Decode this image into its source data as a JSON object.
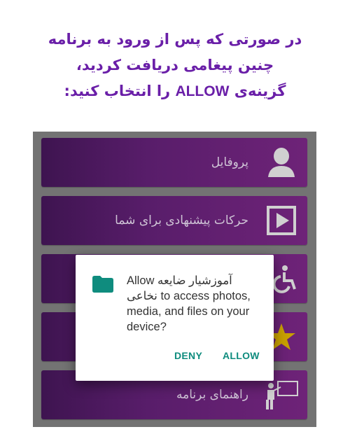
{
  "instruction": {
    "line1": "در صورتی که پس از ورود به برنامه",
    "line2": "چنین پیغامی دریافت کردید،",
    "line3_before": "گزینه‌ی",
    "line3_keyword": "ALLOW",
    "line3_after": "را انتخاب کنید:"
  },
  "menu": {
    "items": [
      {
        "label": "پروفایل",
        "icon": "user-icon"
      },
      {
        "label": "حرکات پیشنهادی برای شما",
        "icon": "play-icon"
      },
      {
        "label": "",
        "icon": "wheelchair-icon"
      },
      {
        "label": "",
        "icon": "star-icon"
      },
      {
        "label": "راهنمای برنامه",
        "icon": "teacher-board-icon"
      }
    ]
  },
  "dialog": {
    "icon": "folder-icon",
    "message_prefix": "Allow",
    "app_name": "آموزشیار ضایعه نخاعی",
    "message_suffix": "to access photos, media, and files on your device?",
    "deny_label": "DENY",
    "allow_label": "ALLOW"
  },
  "colors": {
    "instruction_text": "#6a1fa8",
    "menu_item_dark": "#3e1450",
    "menu_item_light": "#6e2378",
    "phone_frame": "#737373",
    "dialog_button": "#0f8c7e",
    "folder_icon": "#0f8c7e",
    "star_icon": "#c8a000"
  }
}
